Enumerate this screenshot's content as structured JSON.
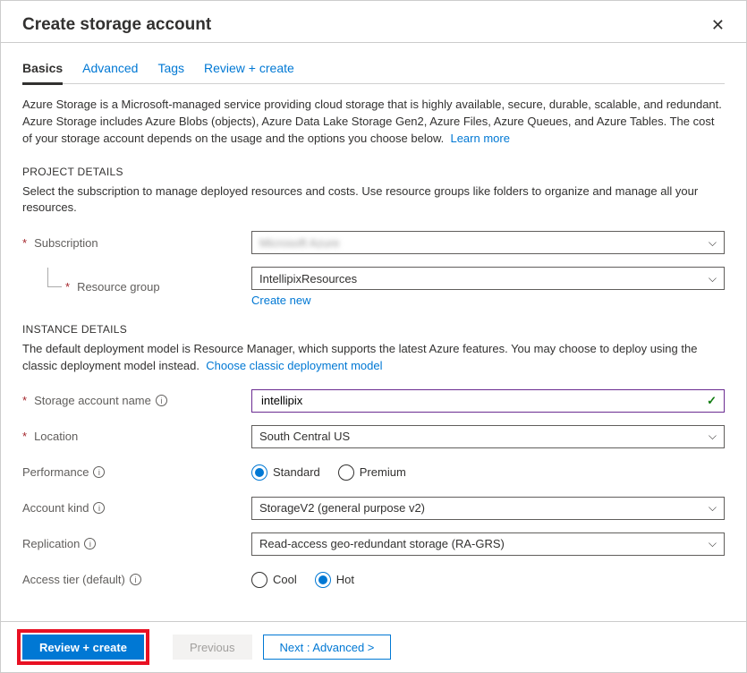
{
  "title": "Create storage account",
  "tabs": [
    "Basics",
    "Advanced",
    "Tags",
    "Review + create"
  ],
  "intro": "Azure Storage is a Microsoft-managed service providing cloud storage that is highly available, secure, durable, scalable, and redundant. Azure Storage includes Azure Blobs (objects), Azure Data Lake Storage Gen2, Azure Files, Azure Queues, and Azure Tables. The cost of your storage account depends on the usage and the options you choose below.",
  "intro_link": "Learn more",
  "project_details": {
    "heading": "PROJECT DETAILS",
    "desc": "Select the subscription to manage deployed resources and costs. Use resource groups like folders to organize and manage all your resources.",
    "subscription_label": "Subscription",
    "subscription_value": "Microsoft Azure",
    "resource_group_label": "Resource group",
    "resource_group_value": "IntellipixResources",
    "create_new": "Create new"
  },
  "instance_details": {
    "heading": "INSTANCE DETAILS",
    "desc": "The default deployment model is Resource Manager, which supports the latest Azure features. You may choose to deploy using the classic deployment model instead.",
    "desc_link": "Choose classic deployment model",
    "storage_name_label": "Storage account name",
    "storage_name_value": "intellipix",
    "location_label": "Location",
    "location_value": "South Central US",
    "performance_label": "Performance",
    "performance_options": [
      "Standard",
      "Premium"
    ],
    "performance_selected": "Standard",
    "account_kind_label": "Account kind",
    "account_kind_value": "StorageV2 (general purpose v2)",
    "replication_label": "Replication",
    "replication_value": "Read-access geo-redundant storage (RA-GRS)",
    "access_tier_label": "Access tier (default)",
    "access_tier_options": [
      "Cool",
      "Hot"
    ],
    "access_tier_selected": "Hot"
  },
  "footer": {
    "review": "Review + create",
    "previous": "Previous",
    "next": "Next : Advanced >"
  }
}
